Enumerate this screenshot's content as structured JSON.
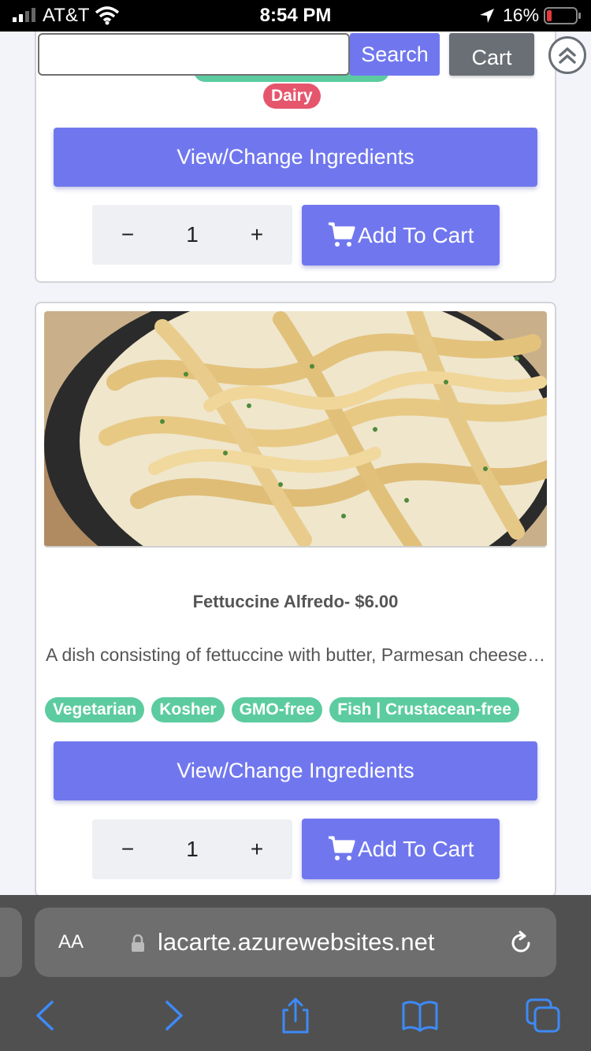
{
  "status_bar": {
    "carrier": "AT&T",
    "time": "8:54 PM",
    "battery": "16%"
  },
  "header": {
    "search_placeholder": "",
    "search_label": "Search",
    "cart_label": "Cart"
  },
  "top_card": {
    "tag": "Dairy",
    "ingredients_label": "View/Change Ingredients",
    "qty_minus": "−",
    "qty_value": "1",
    "qty_plus": "+",
    "add_label": "Add To Cart"
  },
  "dish_card": {
    "title": "Fettuccine Alfredo- $6.00",
    "description": "A dish consisting of fettuccine with butter, Parmesan cheese and cream",
    "tags": [
      "Vegetarian",
      "Kosher",
      "GMO-free",
      "Fish | Crustacean-free"
    ],
    "ingredients_label": "View/Change Ingredients",
    "qty_minus": "−",
    "qty_value": "1",
    "qty_plus": "+",
    "add_label": "Add To Cart"
  },
  "browser": {
    "aa_label": "AA",
    "url": "lacarte.azurewebsites.net"
  },
  "colors": {
    "primary": "#7077ee",
    "tag_green": "#5ccca0",
    "tag_red": "#e5566d",
    "secondary": "#6a6f76"
  },
  "icons": [
    "signal-icon",
    "wifi-icon",
    "location-icon",
    "battery-icon",
    "cart-icon",
    "chevron-double-up-icon",
    "lock-icon",
    "reload-icon",
    "back-icon",
    "forward-icon",
    "share-icon",
    "bookmarks-icon",
    "tabs-icon"
  ]
}
